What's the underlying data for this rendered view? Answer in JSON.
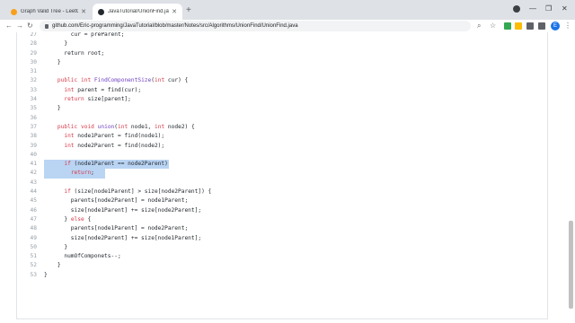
{
  "tabs": [
    {
      "title": "Graph Valid Tree - LeetCode",
      "favicon_color": "#f89f1b"
    },
    {
      "title": "JavaTutorial/UnionFind.java at m",
      "favicon_color": "#24292e"
    }
  ],
  "window_controls": {
    "minimize": "—",
    "maximize": "❐",
    "close": "✕"
  },
  "toolbar": {
    "back": "←",
    "forward": "→",
    "reload": "↻",
    "url": "github.com/Eric-programming/JavaTutorial/blob/master/Notes/src/Algorithms/UnionFind/UnionFind.java",
    "star": "☆",
    "avatar_letter": "E",
    "menu": "⋮"
  },
  "code_lines": [
    {
      "n": "27",
      "html": "        cur = preParent;"
    },
    {
      "n": "28",
      "html": "      }"
    },
    {
      "n": "29",
      "html": "      return root;"
    },
    {
      "n": "30",
      "html": "    }"
    },
    {
      "n": "31",
      "html": ""
    },
    {
      "n": "32",
      "html": "    <span class=\"kw\">public</span> <span class=\"ty\">int</span> <span class=\"fn\">FindComponentSize</span>(<span class=\"ty\">int</span> cur) {"
    },
    {
      "n": "33",
      "html": "      <span class=\"ty\">int</span> parent = find(cur);"
    },
    {
      "n": "34",
      "html": "      <span class=\"kw\">return</span> size[parent];"
    },
    {
      "n": "35",
      "html": "    }"
    },
    {
      "n": "36",
      "html": ""
    },
    {
      "n": "37",
      "html": "    <span class=\"kw\">public</span> <span class=\"ty\">void</span> <span class=\"fn\">union</span>(<span class=\"ty\">int</span> node1, <span class=\"ty\">int</span> node2) {"
    },
    {
      "n": "38",
      "html": "      <span class=\"ty\">int</span> node1Parent = find(node1);"
    },
    {
      "n": "39",
      "html": "      <span class=\"ty\">int</span> node2Parent = find(node2);"
    },
    {
      "n": "40",
      "html": ""
    },
    {
      "n": "41",
      "html": "      <span class=\"kw\">if</span> (node1Parent == node2Parent)",
      "highlight": true
    },
    {
      "n": "42",
      "html": "        <span class=\"kw\">return</span>;",
      "highlight": true
    },
    {
      "n": "43",
      "html": ""
    },
    {
      "n": "44",
      "html": "      <span class=\"kw\">if</span> (size[node1Parent] &gt; size[node2Parent]) {"
    },
    {
      "n": "45",
      "html": "        parents[node2Parent] = node1Parent;"
    },
    {
      "n": "46",
      "html": "        size[node1Parent] += size[node2Parent];"
    },
    {
      "n": "47",
      "html": "      } <span class=\"kw\">else</span> {"
    },
    {
      "n": "48",
      "html": "        parents[node1Parent] = node2Parent;"
    },
    {
      "n": "49",
      "html": "        size[node2Parent] += size[node1Parent];"
    },
    {
      "n": "50",
      "html": "      }"
    },
    {
      "n": "51",
      "html": "      numOfComponets--;"
    },
    {
      "n": "52",
      "html": "    }"
    },
    {
      "n": "53",
      "html": "}"
    }
  ]
}
